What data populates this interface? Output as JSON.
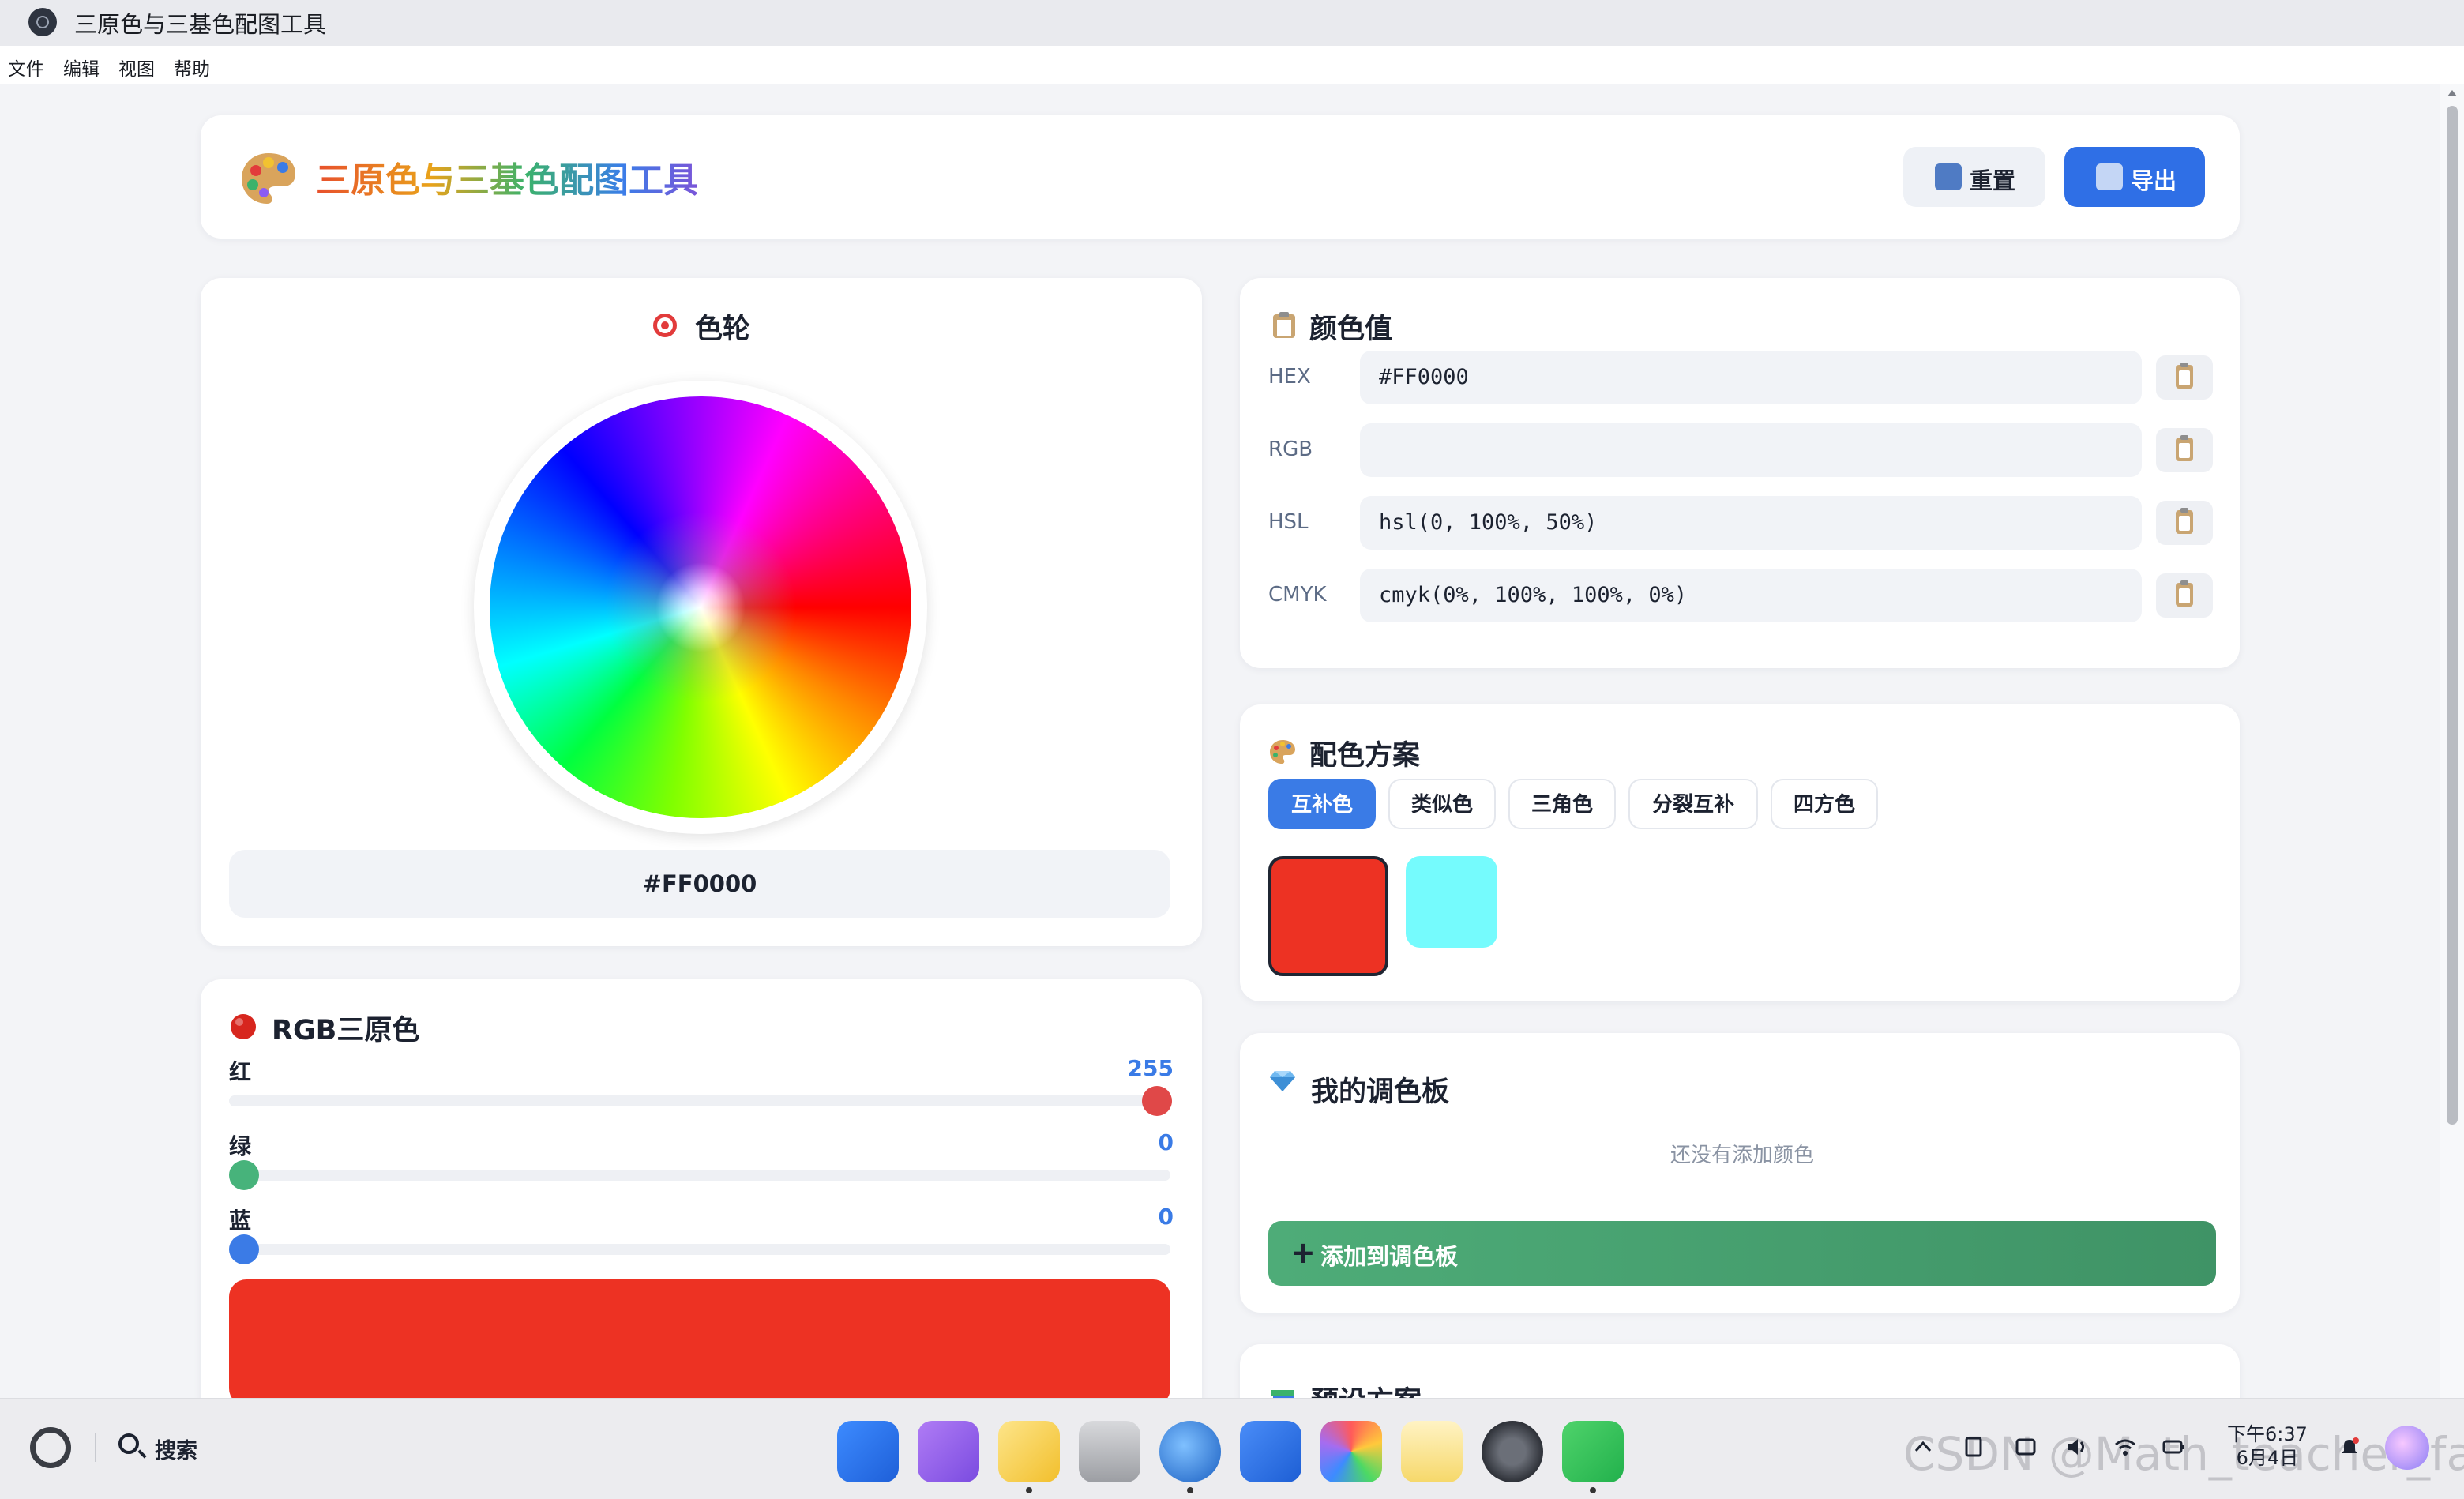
{
  "window": {
    "title": "三原色与三基色配图工具"
  },
  "menu": {
    "items": [
      "文件",
      "编辑",
      "视图",
      "帮助"
    ]
  },
  "header": {
    "title": "三原色与三基色配图工具",
    "reset_label": "重置",
    "export_label": "导出"
  },
  "wheel": {
    "title": "色轮",
    "value": "#FF0000"
  },
  "rgb": {
    "title": "RGB三原色",
    "red_label": "红",
    "red_value": "255",
    "green_label": "绿",
    "green_value": "0",
    "blue_label": "蓝",
    "blue_value": "0",
    "preview_color": "#ED3223"
  },
  "values": {
    "title": "颜色值",
    "hex_label": "HEX",
    "hex": "#FF0000",
    "rgb_label": "RGB",
    "rgb": "",
    "hsl_label": "HSL",
    "hsl": "hsl(0, 100%, 50%)",
    "cmyk_label": "CMYK",
    "cmyk": "cmyk(0%, 100%, 100%, 0%)"
  },
  "schemes": {
    "title": "配色方案",
    "tabs": [
      "互补色",
      "类似色",
      "三角色",
      "分裂互补",
      "四方色"
    ],
    "active_tab": "互补色",
    "swatches": [
      "#ED3223",
      "#75FBFD"
    ]
  },
  "palette": {
    "title": "我的调色板",
    "empty": "还没有添加颜色",
    "add_label": "添加到调色板"
  },
  "presets": {
    "title": "预设方案"
  },
  "taskbar": {
    "search_label": "搜索",
    "time": "下午6:37",
    "date": "6月4日",
    "watermark": "CSDN @Math_teacher_fan",
    "apps": [
      "launcher-icon",
      "multitask-icon",
      "files-icon",
      "trash-icon",
      "browser-icon",
      "mail-icon",
      "photos-icon",
      "notes-icon",
      "settings-icon",
      "wechat-icon"
    ]
  },
  "colors": {
    "accent": "#3A7BE6",
    "red": "#ED3223",
    "green_knob": "#47B37B",
    "blue_knob": "#3B7BE6",
    "cyan": "#75FBFD",
    "add_green": "#4EAC78"
  }
}
